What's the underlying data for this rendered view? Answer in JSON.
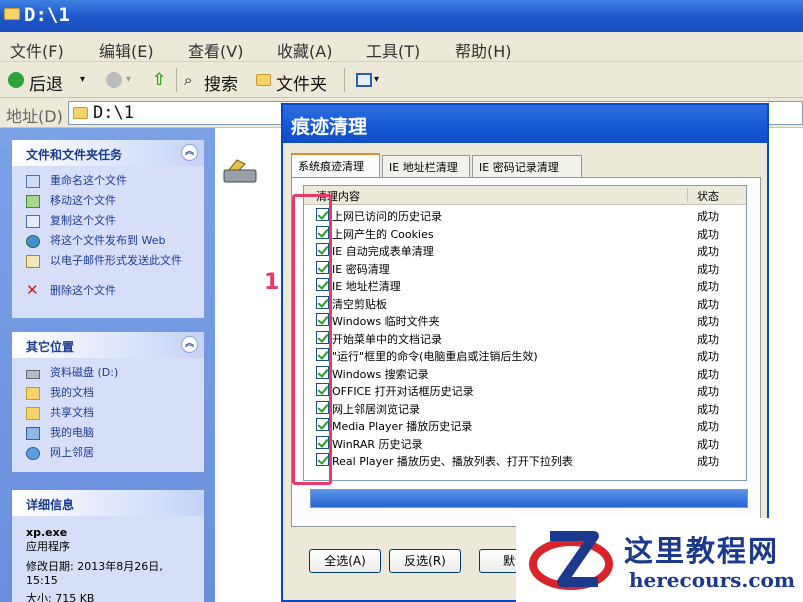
{
  "window": {
    "title": "D:\\1"
  },
  "menu": [
    "文件(F)",
    "编辑(E)",
    "查看(V)",
    "收藏(A)",
    "工具(T)",
    "帮助(H)"
  ],
  "toolbar": {
    "back": "后退",
    "search": "搜索",
    "folders": "文件夹"
  },
  "address": {
    "label": "地址(D)",
    "value": "D:\\1"
  },
  "tasks_panel": {
    "title": "文件和文件夹任务",
    "items": [
      "重命名这个文件",
      "移动这个文件",
      "复制这个文件",
      "将这个文件发布到 Web",
      "以电子邮件形式发送此文件",
      "删除这个文件"
    ]
  },
  "places_panel": {
    "title": "其它位置",
    "items": [
      "资料磁盘 (D:)",
      "我的文档",
      "共享文档",
      "我的电脑",
      "网上邻居"
    ]
  },
  "details_panel": {
    "title": "详细信息",
    "filename": "xp.exe",
    "type": "应用程序",
    "modified_label": "修改日期: 2013年8月26日,",
    "modified_time": "15:15",
    "size_partial": "大小: 715 KB"
  },
  "dialog": {
    "title": "痕迹清理",
    "tabs": [
      "系统痕迹清理",
      "IE 地址栏清理",
      "IE 密码记录清理"
    ],
    "columns": {
      "item": "清理内容",
      "status": "状态"
    },
    "rows": [
      {
        "label": "上网已访问的历史记录",
        "status": "成功"
      },
      {
        "label": "上网产生的 Cookies",
        "status": "成功"
      },
      {
        "label": "IE 自动完成表单清理",
        "status": "成功"
      },
      {
        "label": "IE 密码清理",
        "status": "成功"
      },
      {
        "label": "IE 地址栏清理",
        "status": "成功"
      },
      {
        "label": "清空剪贴板",
        "status": "成功"
      },
      {
        "label": "Windows 临时文件夹",
        "status": "成功"
      },
      {
        "label": "开始菜单中的文档记录",
        "status": "成功"
      },
      {
        "label": "\"运行\"框里的命令(电脑重启或注销后生效)",
        "status": "成功"
      },
      {
        "label": "Windows 搜索记录",
        "status": "成功"
      },
      {
        "label": "OFFICE 打开对话框历史记录",
        "status": "成功"
      },
      {
        "label": "网上邻居浏览记录",
        "status": "成功"
      },
      {
        "label": "Media Player 播放历史记录",
        "status": "成功"
      },
      {
        "label": "WinRAR 历史记录",
        "status": "成功"
      },
      {
        "label": "Real Player 播放历史、播放列表、打开下拉列表",
        "status": "成功"
      }
    ],
    "progress": 1.0,
    "buttons": {
      "select_all": "全选(A)",
      "invert": "反选(R)",
      "default": "默认"
    }
  },
  "annotation": {
    "marker": "1",
    "color": "#e8386c"
  },
  "watermark": {
    "cn": "这里教程网",
    "en": "herecours.com"
  }
}
